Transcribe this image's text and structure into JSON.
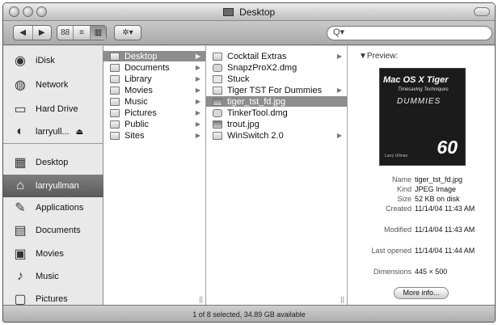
{
  "window": {
    "title": "Desktop"
  },
  "toolbar": {
    "back_label": "◀",
    "forward_label": "▶",
    "view_icon_label": "88",
    "view_list_label": "≡",
    "view_column_label": "▥",
    "action_label": "✲▾",
    "search_placeholder": "",
    "search_icon": "Q▾"
  },
  "sidebar": {
    "items": [
      {
        "label": "iDisk",
        "icon": "idisk-icon"
      },
      {
        "label": "Network",
        "icon": "network-icon"
      },
      {
        "label": "Hard Drive",
        "icon": "hard-drive-icon"
      },
      {
        "label": "larryull...",
        "icon": "user-disk-icon",
        "eject": "⏏"
      },
      {
        "label": "Desktop",
        "icon": "desktop-icon"
      },
      {
        "label": "larryullman",
        "icon": "home-icon",
        "selected": true
      },
      {
        "label": "Applications",
        "icon": "applications-icon"
      },
      {
        "label": "Documents",
        "icon": "documents-icon"
      },
      {
        "label": "Movies",
        "icon": "movies-icon"
      },
      {
        "label": "Music",
        "icon": "music-icon"
      },
      {
        "label": "Pictures",
        "icon": "pictures-icon"
      }
    ]
  },
  "columns": {
    "col1": [
      {
        "label": "Desktop",
        "kind": "folder",
        "arrow": "▶",
        "selected": true
      },
      {
        "label": "Documents",
        "kind": "folder",
        "arrow": "▶"
      },
      {
        "label": "Library",
        "kind": "folder",
        "arrow": "▶"
      },
      {
        "label": "Movies",
        "kind": "folder",
        "arrow": "▶"
      },
      {
        "label": "Music",
        "kind": "folder",
        "arrow": "▶"
      },
      {
        "label": "Pictures",
        "kind": "folder",
        "arrow": "▶"
      },
      {
        "label": "Public",
        "kind": "folder",
        "arrow": "▶"
      },
      {
        "label": "Sites",
        "kind": "folder",
        "arrow": "▶"
      }
    ],
    "col2": [
      {
        "label": "Cocktail Extras",
        "kind": "folder",
        "arrow": "▶"
      },
      {
        "label": "SnapzProX2.dmg",
        "kind": "dmg",
        "arrow": ""
      },
      {
        "label": "Stuck",
        "kind": "file",
        "arrow": ""
      },
      {
        "label": "Tiger TST For Dummies",
        "kind": "folder",
        "arrow": "▶"
      },
      {
        "label": "tiger_tst_fd.jpg",
        "kind": "img",
        "arrow": "",
        "selected": true
      },
      {
        "label": "TinkerTool.dmg",
        "kind": "dmg",
        "arrow": ""
      },
      {
        "label": "trout.jpg",
        "kind": "img",
        "arrow": ""
      },
      {
        "label": "WinSwitch 2.0",
        "kind": "folder",
        "arrow": "▶"
      }
    ]
  },
  "preview": {
    "heading": "▼Preview:",
    "cover": {
      "title": "Mac OS X Tiger",
      "subtitle": "Timesaving Techniques",
      "brand": "DUMMIES",
      "number": "60",
      "author": "Larry Ullman"
    },
    "meta": [
      {
        "key": "Name",
        "value": "tiger_tst_fd.jpg"
      },
      {
        "key": "Kind",
        "value": "JPEG Image"
      },
      {
        "key": "Size",
        "value": "52 KB on disk"
      },
      {
        "key": "Created",
        "value": "11/14/04 11:43 AM"
      },
      {
        "key": "Modified",
        "value": "11/14/04 11:43 AM"
      },
      {
        "key": "Last opened",
        "value": "11/14/04 11:44 AM"
      },
      {
        "key": "Dimensions",
        "value": "445 × 500"
      }
    ],
    "more_info": "More info..."
  },
  "status": {
    "text": "1 of 8 selected, 34.89 GB available"
  }
}
